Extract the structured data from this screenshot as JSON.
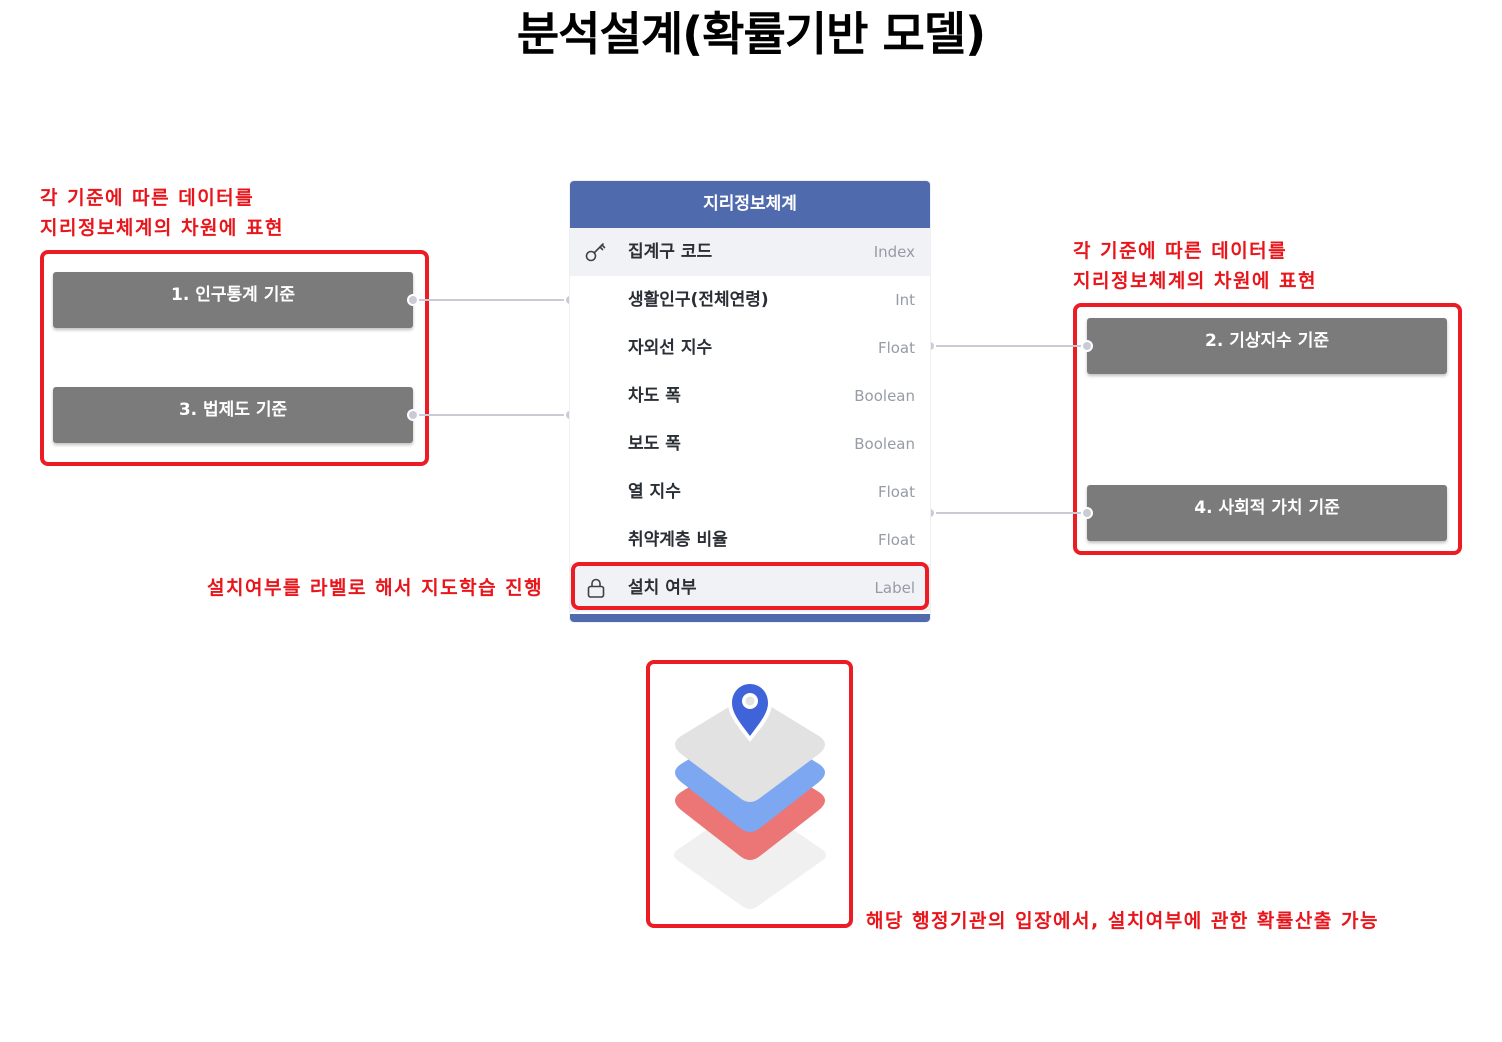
{
  "title": "분석설계(확률기반 모델)",
  "notes": {
    "left_top": [
      "각 기준에 따른 데이터를",
      "지리정보체계의 차원에 표현"
    ],
    "right_top": [
      "각 기준에 따른 데이터를",
      "지리정보체계의 차원에 표현"
    ],
    "label_note": "설치여부를 라벨로 해서 지도학습 진행",
    "bottom_note": "해당 행정기관의 입장에서, 설치여부에 관한 확률산출 가능"
  },
  "criteria": {
    "c1": "1. 인구통계 기준",
    "c2": "2. 기상지수 기준",
    "c3": "3. 법제도 기준",
    "c4": "4. 사회적 가치 기준"
  },
  "table": {
    "header": "지리정보체계",
    "rows": [
      {
        "name": "집계구 코드",
        "type": "Index",
        "icon": "key-icon"
      },
      {
        "name": "생활인구(전체연령)",
        "type": "Int"
      },
      {
        "name": "자외선 지수",
        "type": "Float"
      },
      {
        "name": "차도 폭",
        "type": "Boolean"
      },
      {
        "name": "보도 폭",
        "type": "Boolean"
      },
      {
        "name": "열 지수",
        "type": "Float"
      },
      {
        "name": "취약계층 비율",
        "type": "Float"
      },
      {
        "name": "설치 여부",
        "type": "Label",
        "icon": "lock-icon"
      }
    ]
  },
  "colors": {
    "accent_red": "#ec1c24",
    "table_header": "#4f6aad",
    "criteria_box": "#7b7b7b",
    "pin": "#3f63d8"
  },
  "illustration": "map-layers-pin-icon"
}
